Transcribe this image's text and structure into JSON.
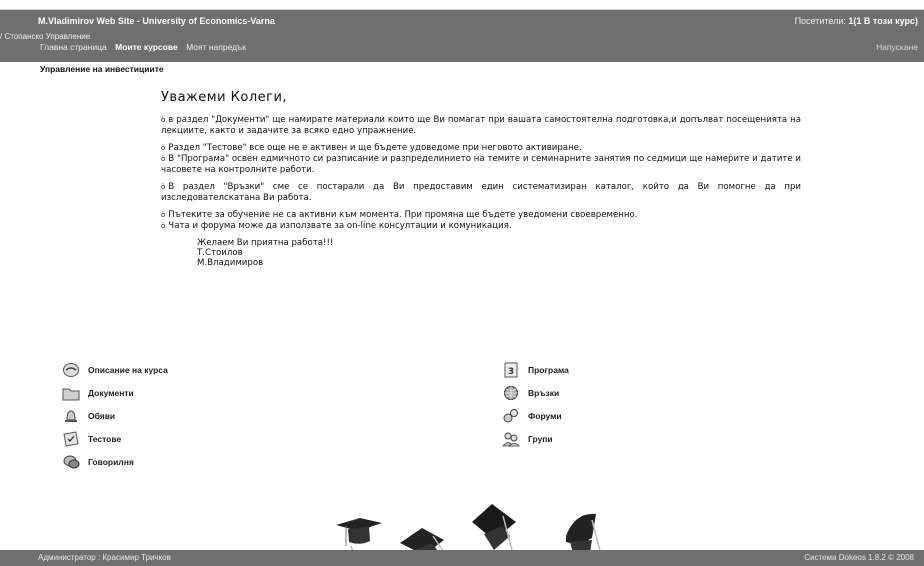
{
  "header": {
    "site_title": "M.Vladimirov Web Site - University of Economics-Varna",
    "visitors_label": "Посетители: ",
    "visitors_value": "1(1 В този курс)",
    "breadcrumb": "/ Стопанско Управление",
    "nav": [
      {
        "label": "Главна страница"
      },
      {
        "label": "Моите курсове"
      },
      {
        "label": "Моят напредък"
      }
    ],
    "logout": "Напускане"
  },
  "course": {
    "title": "Управление на инвестициите"
  },
  "intro": {
    "greeting": "Уважеми Колеги,",
    "bullet": "ò",
    "p1": "в раздел \"Документи\" ще намирате материали които ще Ви помагат при вашата самостоятелна подготовка,и допълват посещенията на лекциите, както и задачите за всяко едно упражнение.",
    "p2a": "Раздел \"Тестове\" все още не е активен и ще бъдете удоведоме при неговото активиране.",
    "p2b": "В \"Програма\" освен едмичното си разписание и разпределинието на темите и семинарните занятия по седмици ще намерите и датите и часовете на контролните работи.",
    "p3": "В раздел \"Връзки\" сме се постарали да Ви предоставим един систематизиран каталог, който да Ви помогне да при изследователскатана Ви работа.",
    "p4a": "Пътеките за обучение не са активни към момента. При промяна ще бъдете уведомени своевременно.",
    "p4b": "Чата и форума може да използвате за on-line консултации и комуникация.",
    "sign1": "Желаем Ви приятна работа!!!",
    "sign2": "Т.Стоилов",
    "sign3": "М.Владимиров"
  },
  "tools": {
    "left": [
      {
        "label": "Описание на курса",
        "icon": "course-description-icon"
      },
      {
        "label": "Документи",
        "icon": "folder-icon"
      },
      {
        "label": "Обяви",
        "icon": "bell-icon"
      },
      {
        "label": "Тестове",
        "icon": "tests-icon"
      },
      {
        "label": "Говорилня",
        "icon": "chat-icon"
      }
    ],
    "right": [
      {
        "label": "Програма",
        "icon": "program-icon"
      },
      {
        "label": "Връзки",
        "icon": "globe-icon"
      },
      {
        "label": "Форуми",
        "icon": "forum-icon"
      },
      {
        "label": "Групи",
        "icon": "groups-icon"
      }
    ]
  },
  "footer": {
    "admin": "Администратор : Красимир Тричков",
    "system": "Система Dokeos 1.8.2 © 2008"
  }
}
